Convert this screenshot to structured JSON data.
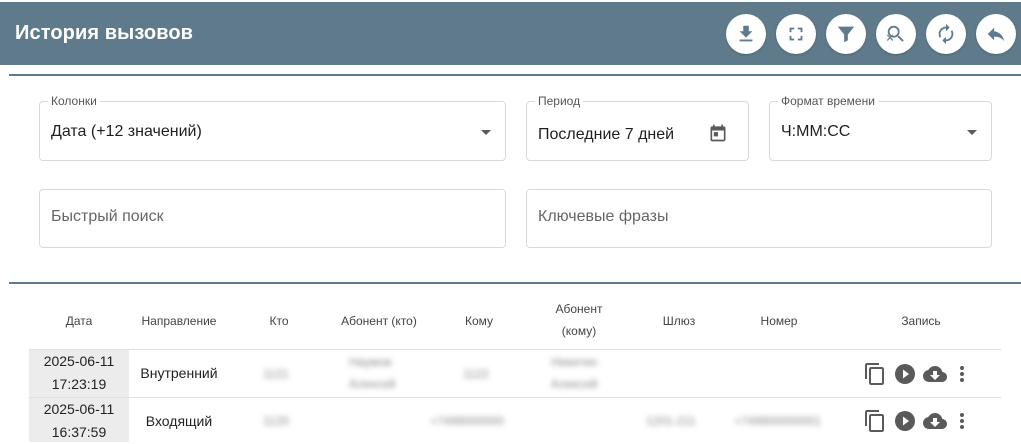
{
  "header": {
    "title": "История вызовов",
    "buttons": [
      {
        "name": "download-button",
        "icon": "download-icon"
      },
      {
        "name": "fullscreen-button",
        "icon": "fullscreen-icon"
      },
      {
        "name": "filter-button",
        "icon": "filter-icon"
      },
      {
        "name": "clear-search-button",
        "icon": "search-off-icon"
      },
      {
        "name": "refresh-button",
        "icon": "refresh-icon"
      },
      {
        "name": "back-button",
        "icon": "reply-icon"
      }
    ]
  },
  "filters": {
    "columns": {
      "label": "Колонки",
      "value": "Дата (+12 значений)"
    },
    "period": {
      "label": "Период",
      "value": "Последние 7 дней"
    },
    "time_format": {
      "label": "Формат времени",
      "value": "Ч:ММ:СС"
    },
    "quick_search": {
      "placeholder": "Быстрый поиск"
    },
    "key_phrases": {
      "placeholder": "Ключевые фразы"
    }
  },
  "table": {
    "headers": [
      "Дата",
      "Направление",
      "Кто",
      "Абонент (кто)",
      "Кому",
      "Абонент\n(кому)",
      "Шлюз",
      "Номер",
      "Запись"
    ],
    "rows": [
      {
        "date": "2025-06-11",
        "time": "17:23:19",
        "direction": "Внутренний",
        "who": "1121",
        "who_subscriber_1": "Наумов",
        "who_subscriber_2": "Алексей",
        "to": "1122",
        "to_subscriber_1": "Никитин",
        "to_subscriber_2": "Алексей",
        "gateway": "",
        "number": ""
      },
      {
        "date": "2025-06-11",
        "time": "16:37:59",
        "direction": "Входящий",
        "who": "1120",
        "who_subscriber_1": "",
        "who_subscriber_2": "",
        "to": "+7499000000",
        "to_subscriber_1": "",
        "to_subscriber_2": "",
        "gateway": "1201-211",
        "number": "+749900000001"
      }
    ],
    "row_actions": [
      "copy-icon",
      "play-icon",
      "cloud-download-icon",
      "more-vert-icon"
    ]
  },
  "colors": {
    "header_bg": "#5f7b8b",
    "date_cell_bg": "#ececec",
    "icon_gray": "#5a5a5a"
  }
}
